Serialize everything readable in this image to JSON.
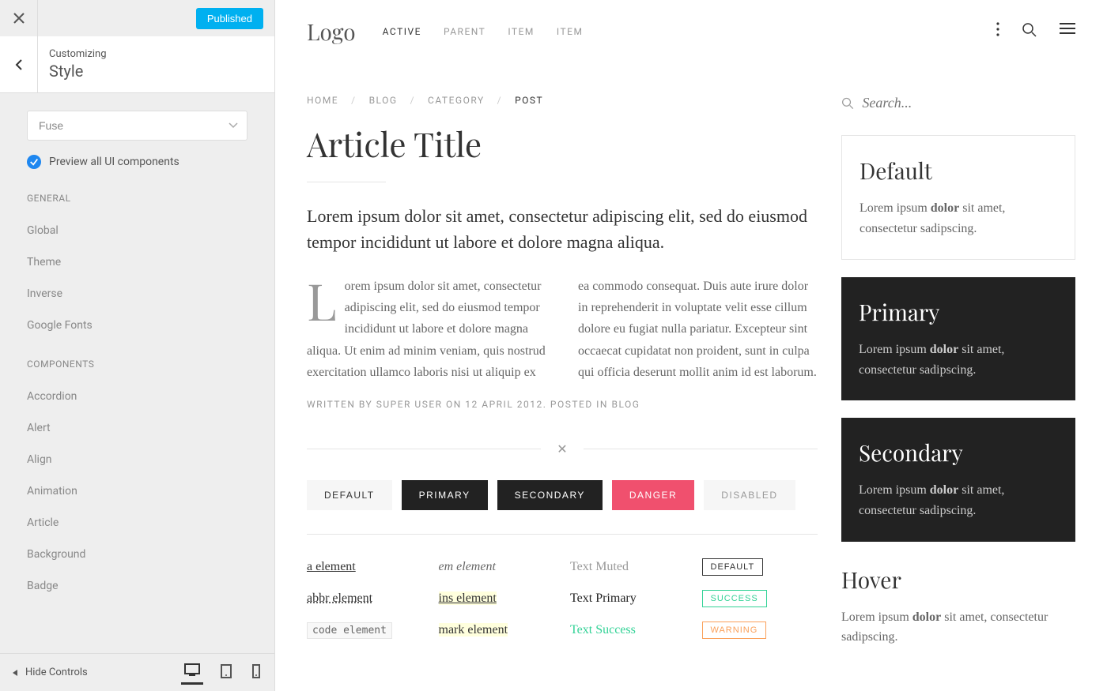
{
  "sidebar": {
    "publish_btn": "Published",
    "customizing_label": "Customizing",
    "section_title": "Style",
    "select_value": "Fuse",
    "preview_label": "Preview all UI components",
    "hide_controls": "Hide Controls",
    "groups": [
      {
        "heading": "GENERAL",
        "items": [
          "Global",
          "Theme",
          "Inverse",
          "Google Fonts"
        ]
      },
      {
        "heading": "COMPONENTS",
        "items": [
          "Accordion",
          "Alert",
          "Align",
          "Animation",
          "Article",
          "Background",
          "Badge"
        ]
      }
    ]
  },
  "preview": {
    "logo": "Logo",
    "nav": [
      "ACTIVE",
      "PARENT",
      "ITEM",
      "ITEM"
    ],
    "breadcrumb": [
      "HOME",
      "BLOG",
      "CATEGORY",
      "POST"
    ],
    "article_title": "Article Title",
    "lead": "Lorem ipsum dolor sit amet, consectetur adipiscing elit, sed do eiusmod tempor incididunt ut labore et dolore magna aliqua.",
    "body": "Lorem ipsum dolor sit amet, consectetur adipiscing elit, sed do eiusmod tempor incididunt ut labore et dolore magna aliqua. Ut enim ad minim veniam, quis nostrud exercitation ullamco laboris nisi ut aliquip ex ea commodo consequat. Duis aute irure dolor in reprehenderit in voluptate velit esse cillum dolore eu fugiat nulla pariatur. Excepteur sint occaecat cupidatat non proident, sunt in culpa qui officia deserunt mollit anim id est laborum.",
    "meta": "WRITTEN BY SUPER USER ON 12 APRIL 2012. POSTED IN BLOG",
    "buttons": {
      "default": "DEFAULT",
      "primary": "PRIMARY",
      "secondary": "SECONDARY",
      "danger": "DANGER",
      "disabled": "DISABLED"
    },
    "text_examples": {
      "a": "a element",
      "abbr": "abbr element",
      "code": "code element",
      "em": "em element",
      "ins": "ins element",
      "mark": "mark element",
      "muted": "Text Muted",
      "primary": "Text Primary",
      "success": "Text Success"
    },
    "labels": {
      "default": "DEFAULT",
      "success": "SUCCESS",
      "warning": "WARNING"
    },
    "search_placeholder": "Search...",
    "cards": [
      {
        "title": "Default",
        "text_pre": "Lorem ipsum ",
        "text_bold": "dolor",
        "text_post": " sit amet, consectetur sadipscing."
      },
      {
        "title": "Primary",
        "text_pre": "Lorem ipsum ",
        "text_bold": "dolor",
        "text_post": " sit amet, consectetur sadipscing."
      },
      {
        "title": "Secondary",
        "text_pre": "Lorem ipsum ",
        "text_bold": "dolor",
        "text_post": " sit amet, consectetur sadipscing."
      }
    ],
    "hover_title": "Hover",
    "hover_text_pre": "Lorem ipsum ",
    "hover_text_bold": "dolor",
    "hover_text_post": " sit amet, consectetur sadipscing."
  }
}
